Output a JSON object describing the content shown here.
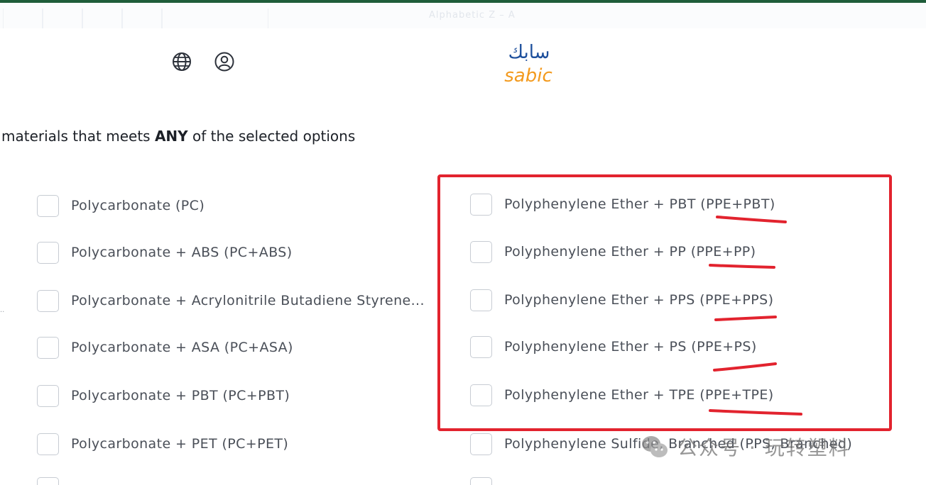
{
  "header": {
    "ghost_text": "Alphabetic Z – A",
    "globe_icon": "globe-icon",
    "user_icon": "user-icon",
    "logo_arabic": "سابك",
    "logo_latin": "sabic"
  },
  "filter": {
    "heading_prefix": "materials that meets ",
    "heading_emphasis": "ANY",
    "heading_suffix": " of the selected options"
  },
  "options_left": [
    {
      "label": "Polycarbonate (PC)",
      "checked": false
    },
    {
      "label": "Polycarbonate + ABS (PC+ABS)",
      "checked": false
    },
    {
      "label": "Polycarbonate + Acrylonitrile Butadiene Styrene...",
      "checked": false
    },
    {
      "label": "Polycarbonate + ASA (PC+ASA)",
      "checked": false
    },
    {
      "label": "Polycarbonate + PBT (PC+PBT)",
      "checked": false
    },
    {
      "label": "Polycarbonate + PET (PC+PET)",
      "checked": false
    }
  ],
  "options_right": [
    {
      "label": "Polyphenylene Ether + PBT (PPE+PBT)",
      "checked": false
    },
    {
      "label": "Polyphenylene Ether + PP (PPE+PP)",
      "checked": false
    },
    {
      "label": "Polyphenylene Ether + PPS (PPE+PPS)",
      "checked": false
    },
    {
      "label": "Polyphenylene Ether + PS (PPE+PS)",
      "checked": false
    },
    {
      "label": "Polyphenylene Ether + TPE (PPE+TPE)",
      "checked": false
    },
    {
      "label": "Polyphenylene Sulfide, Branched (PPS, Branched)",
      "checked": false
    }
  ],
  "annotation": {
    "box_color": "#e2232e",
    "underline_color": "#e2232e"
  },
  "watermark": {
    "text": "公众号 · 玩转塑料",
    "icon": "wechat-icon"
  },
  "colors": {
    "brand_blue": "#1d4f9c",
    "brand_orange": "#f39a1e",
    "top_stripe": "#1f5d3a"
  }
}
